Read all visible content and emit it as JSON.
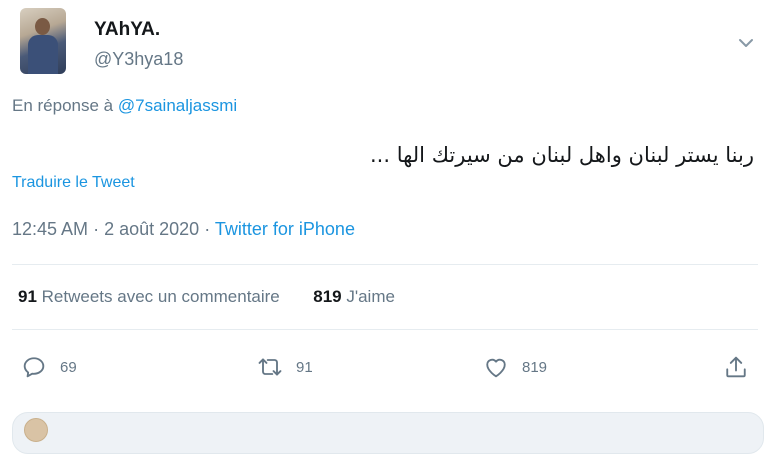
{
  "author": {
    "name": "YAhYA.",
    "handle": "@Y3hya18"
  },
  "reply": {
    "prefix": "En réponse à",
    "mention": "@7sainaljassmi"
  },
  "tweet": {
    "text": "ربنا يستر لبنان واهل لبنان من سيرتك الها ..."
  },
  "translate_label": "Traduire le Tweet",
  "meta": {
    "time": "12:45 AM",
    "date": "2 août 2020",
    "separator": "·",
    "source": "Twitter for iPhone"
  },
  "stats": {
    "retweets_count": "91",
    "retweets_label": "Retweets avec un commentaire",
    "likes_count": "819",
    "likes_label": "J'aime"
  },
  "actions": {
    "reply_count": "69",
    "retweet_count": "91",
    "like_count": "819"
  },
  "icons": [
    "chevron-down-icon",
    "reply-icon",
    "retweet-icon",
    "heart-icon",
    "share-icon"
  ],
  "colors": {
    "link": "#1b95e0",
    "muted": "#657786",
    "text": "#14171a"
  }
}
